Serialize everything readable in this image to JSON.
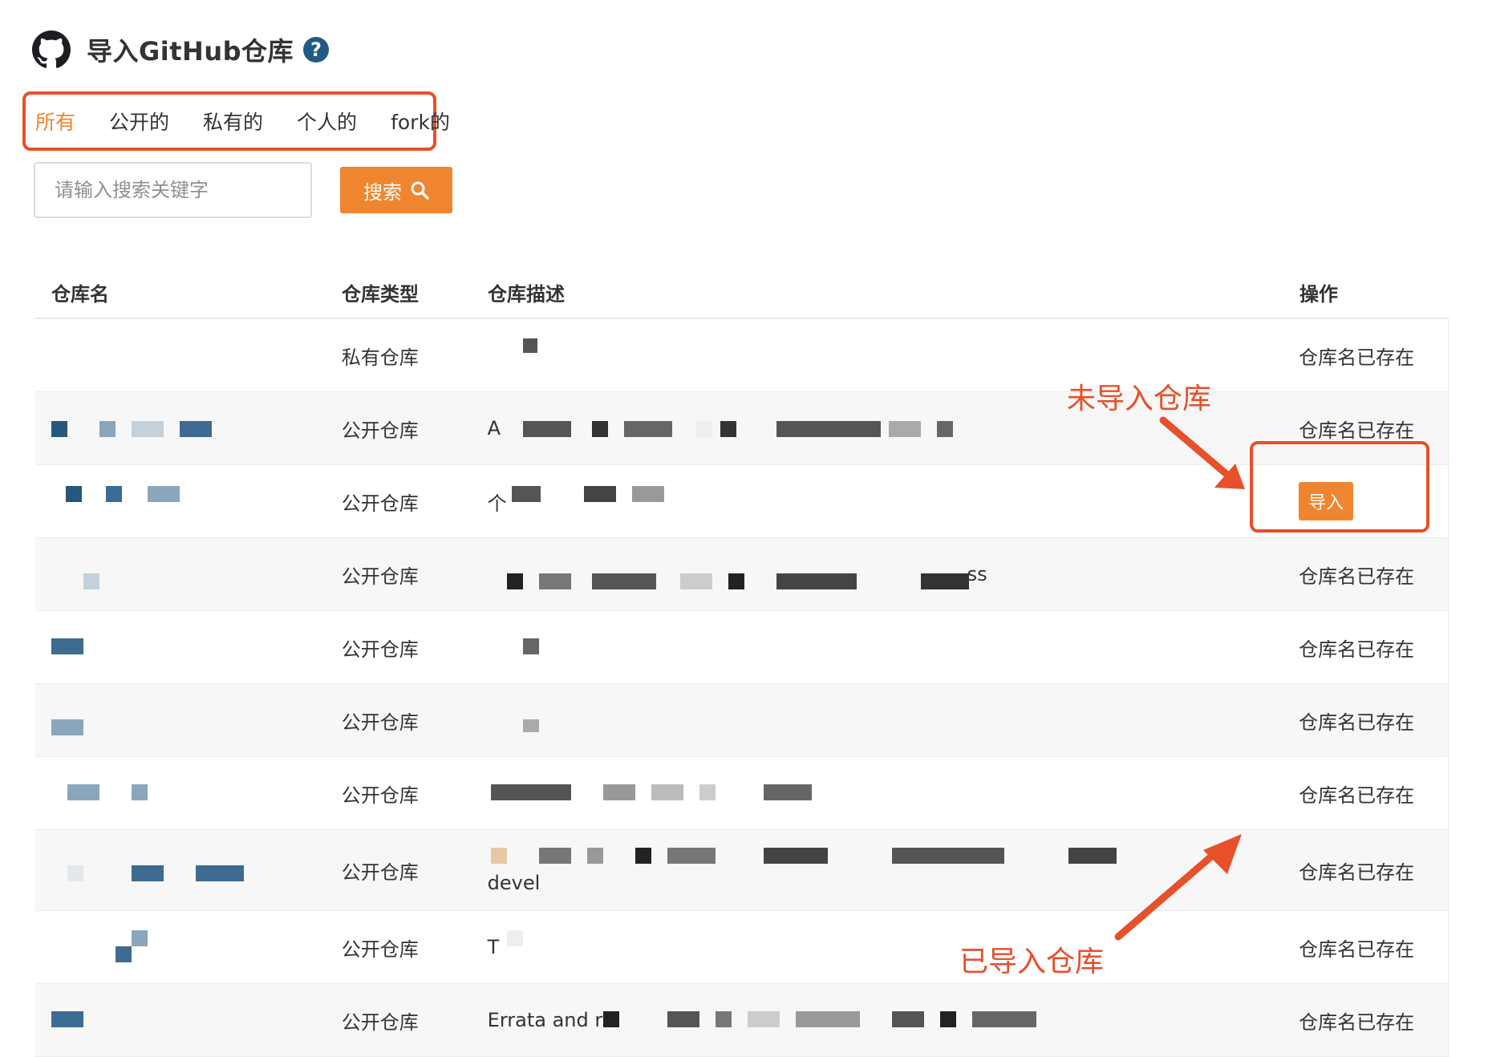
{
  "header": {
    "title": "导入GitHub仓库",
    "help": "?"
  },
  "tabs": [
    "所有",
    "公开的",
    "私有的",
    "个人的",
    "fork的"
  ],
  "search": {
    "placeholder": "请输入搜索关键字",
    "button": "搜索"
  },
  "table": {
    "columns": [
      "仓库名",
      "仓库类型",
      "仓库描述",
      "操作"
    ],
    "rows": [
      {
        "type": "私有仓库",
        "desc": "",
        "action": "仓库名已存在"
      },
      {
        "type": "公开仓库",
        "desc": "A",
        "action": "仓库名已存在"
      },
      {
        "type": "公开仓库",
        "desc": "个",
        "action": "导入"
      },
      {
        "type": "公开仓库",
        "desc": "ss",
        "action": "仓库名已存在"
      },
      {
        "type": "公开仓库",
        "desc": "",
        "action": "仓库名已存在"
      },
      {
        "type": "公开仓库",
        "desc": "",
        "action": "仓库名已存在"
      },
      {
        "type": "公开仓库",
        "desc": "",
        "action": "仓库名已存在"
      },
      {
        "type": "公开仓库",
        "desc": "devel",
        "action": "仓库名已存在"
      },
      {
        "type": "公开仓库",
        "desc": "T",
        "action": "仓库名已存在"
      },
      {
        "type": "公开仓库",
        "desc": "Errata and r",
        "action": "仓库名已存在"
      }
    ]
  },
  "annotations": {
    "not_imported": "未导入仓库",
    "imported": "已导入仓库"
  },
  "colors": {
    "accent": "#f08530",
    "annotation": "#e84f2b",
    "help": "#225a87"
  }
}
